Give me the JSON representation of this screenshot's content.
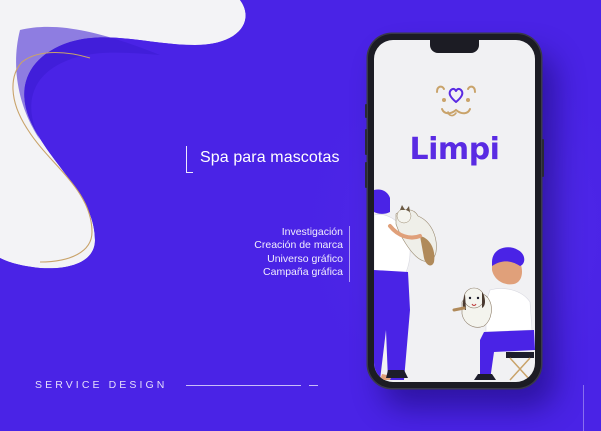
{
  "title": "Spa para mascotas",
  "services": [
    "Investigación",
    "Creación de marca",
    "Universo gráfico",
    "Campaña gráfica"
  ],
  "footer_label": "SERVICE DESIGN",
  "phone": {
    "brand_name": "Limpi"
  },
  "colors": {
    "background": "#4a23e6",
    "accent_wave": "#3a1bd0",
    "gold_line": "#c9a36a",
    "brand_purple": "#5a2be3"
  },
  "icons": {
    "logo": "dog-face-heart-icon"
  }
}
